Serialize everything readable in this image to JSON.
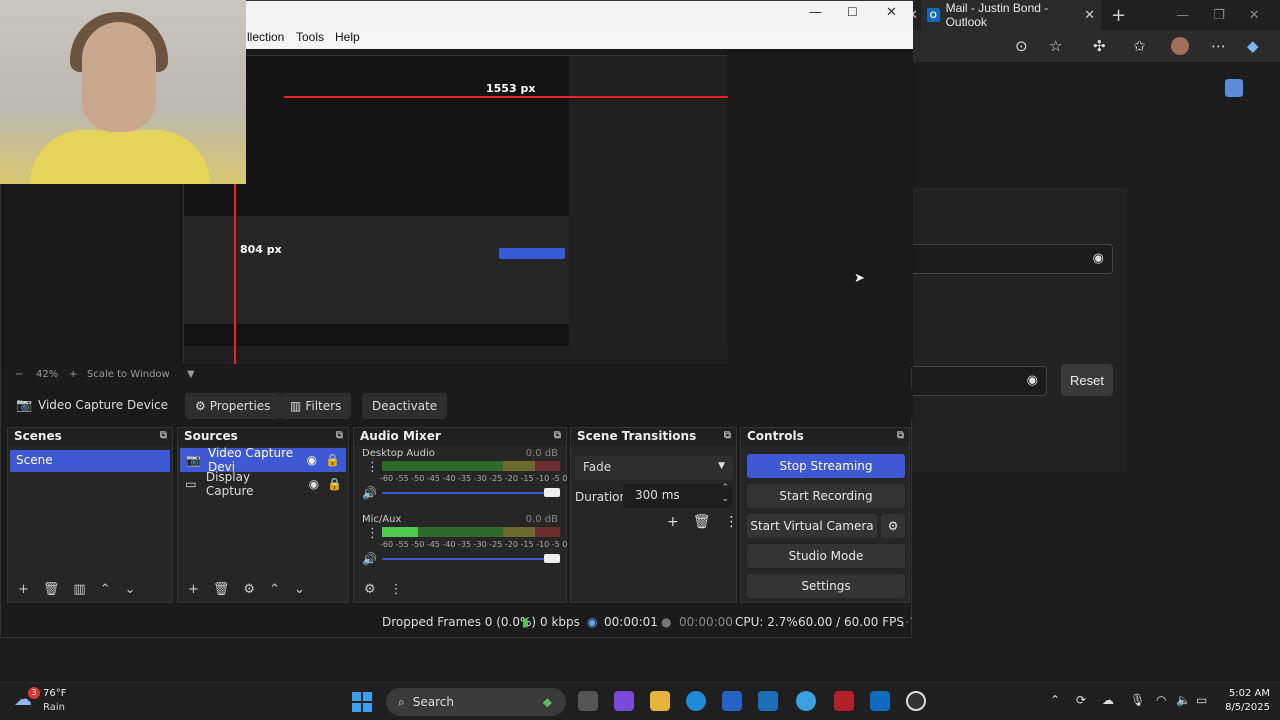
{
  "edge": {
    "tab_title": "Mail - Justin Bond - Outlook",
    "reset_label": "Reset"
  },
  "obs": {
    "menu": [
      "llection",
      "Tools",
      "Help"
    ],
    "preview": {
      "measure_h": "1553 px",
      "measure_v": "804 px"
    },
    "zoom": {
      "minus": "−",
      "level": "42%",
      "plus": "+",
      "mode": "Scale to Window"
    },
    "context": {
      "source_name": "Video Capture Device",
      "properties": "Properties",
      "filters": "Filters",
      "deactivate": "Deactivate"
    },
    "docks": {
      "scenes": {
        "title": "Scenes",
        "items": [
          "Scene"
        ]
      },
      "sources": {
        "title": "Sources",
        "items": [
          "Video Capture Devi",
          "Display Capture"
        ]
      },
      "mixer": {
        "title": "Audio Mixer",
        "channels": [
          {
            "name": "Desktop Audio",
            "db": "0.0 dB",
            "level": 0
          },
          {
            "name": "Mic/Aux",
            "db": "0.0 dB",
            "level": 0.2
          }
        ],
        "ticks": "-60 -55 -50 -45 -40 -35 -30 -25 -20 -15 -10 -5 0"
      },
      "transitions": {
        "title": "Scene Transitions",
        "selected": "Fade",
        "duration_label": "Duration",
        "duration_value": "300 ms"
      },
      "controls": {
        "title": "Controls",
        "stop_streaming": "Stop Streaming",
        "start_recording": "Start Recording",
        "start_virtual_camera": "Start Virtual Camera",
        "studio_mode": "Studio Mode",
        "settings": "Settings"
      }
    },
    "status": {
      "dropped": "Dropped Frames 0 (0.0%)",
      "kbps": "0 kbps",
      "stream_time": "00:00:01",
      "rec_time": "00:00:00",
      "cpu": "CPU: 2.7%",
      "fps": "60.00 / 60.00 FPS"
    }
  },
  "taskbar": {
    "weather_badge": "3",
    "weather_temp": "76°F",
    "weather_cond": "Rain",
    "search": "Search",
    "time": "5:02 AM",
    "date": "8/5/2025"
  },
  "colors": {
    "accent": "#3f58d3",
    "stream_red": "#e22222"
  }
}
